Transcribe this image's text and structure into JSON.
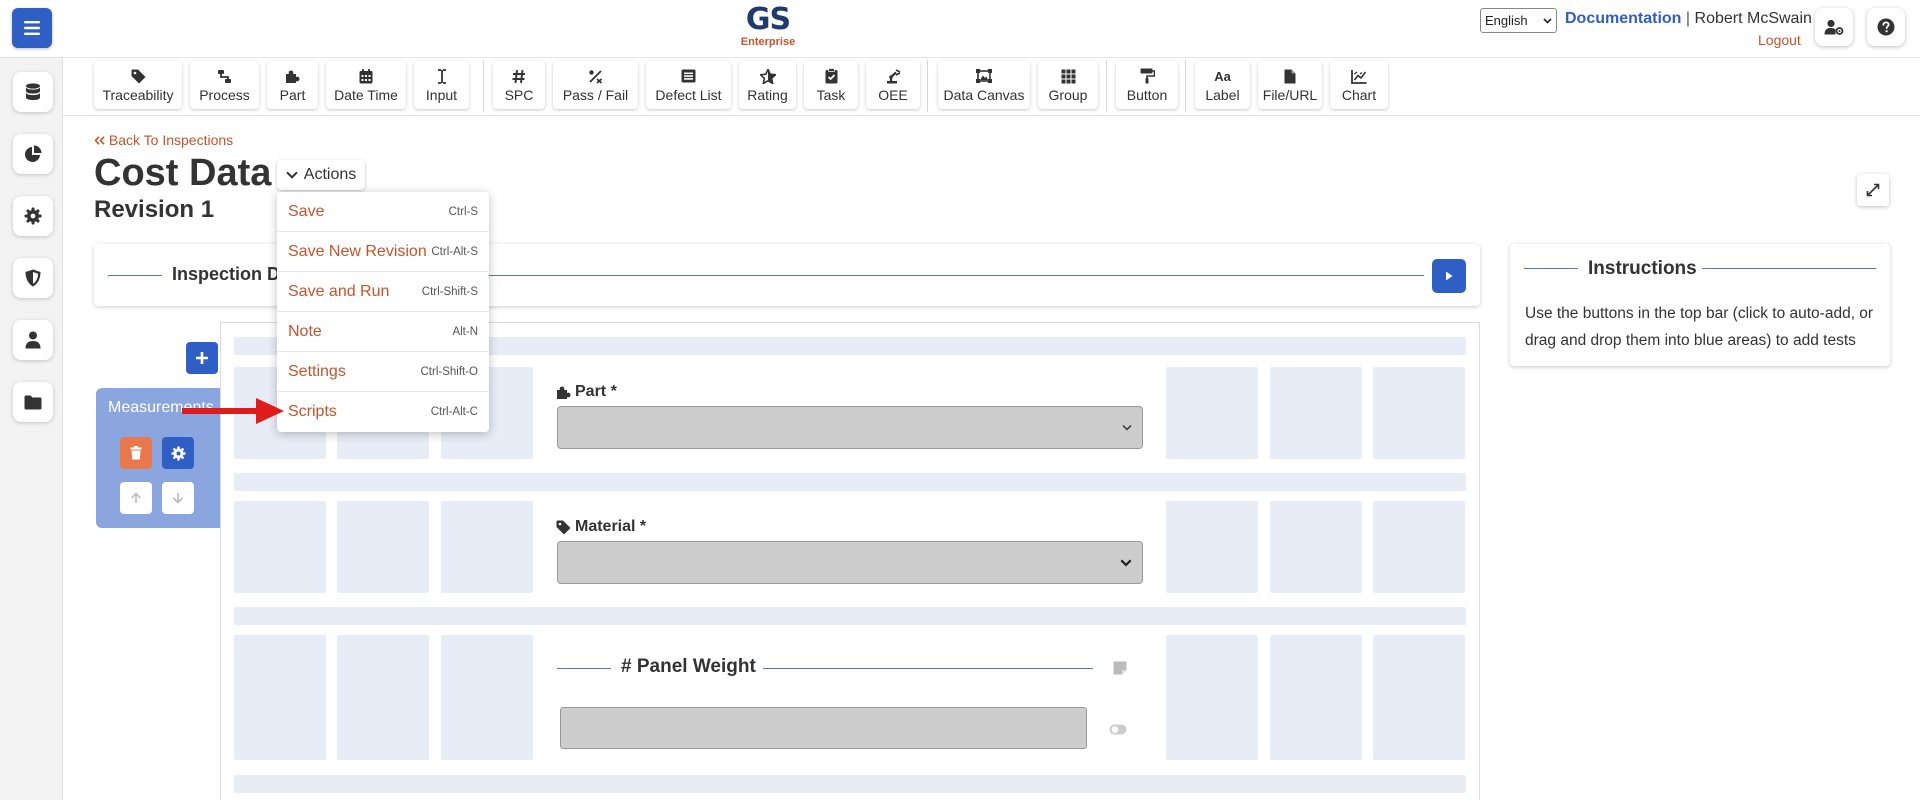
{
  "header": {
    "logo_main": "GS",
    "logo_sub": "Enterprise",
    "language": "English",
    "documentation": "Documentation",
    "separator": "|",
    "user_name": "Robert McSwain",
    "logout": "Logout",
    "colors": {
      "primary": "#2f5fc4",
      "accent": "#c7532c",
      "logo": "#1f3a6e"
    }
  },
  "sidebar": {
    "items": [
      {
        "icon": "database-icon"
      },
      {
        "icon": "pie-chart-icon"
      },
      {
        "icon": "gear-icon"
      },
      {
        "icon": "shield-icon"
      },
      {
        "icon": "user-icon"
      },
      {
        "icon": "folder-icon"
      }
    ]
  },
  "toolbar": {
    "tools": [
      {
        "label": "Traceability",
        "icon": "tag-icon"
      },
      {
        "label": "Process",
        "icon": "process-icon"
      },
      {
        "label": "Part",
        "icon": "puzzle-icon"
      },
      {
        "label": "Date Time",
        "icon": "calendar-icon"
      },
      {
        "label": "Input",
        "icon": "text-cursor-icon"
      },
      {
        "label": "SPC",
        "icon": "hash-icon"
      },
      {
        "label": "Pass / Fail",
        "icon": "percent-icon"
      },
      {
        "label": "Defect List",
        "icon": "list-icon"
      },
      {
        "label": "Rating",
        "icon": "star-icon"
      },
      {
        "label": "Task",
        "icon": "clipboard-check-icon"
      },
      {
        "label": "OEE",
        "icon": "robot-arm-icon"
      },
      {
        "label": "Data Canvas",
        "icon": "canvas-icon"
      },
      {
        "label": "Group",
        "icon": "grid-icon"
      },
      {
        "label": "Button",
        "icon": "paint-roller-icon"
      },
      {
        "label": "Label",
        "icon": "font-icon"
      },
      {
        "label": "File/URL",
        "icon": "file-icon"
      },
      {
        "label": "Chart",
        "icon": "chart-icon"
      }
    ],
    "aa_glyph": "Aa"
  },
  "main": {
    "back_link": "Back To Inspections",
    "title": "Cost Data",
    "revision": "Revision 1",
    "actions_label": "Actions",
    "actions_menu": [
      {
        "label": "Save",
        "shortcut": "Ctrl-S"
      },
      {
        "label": "Save New Revision",
        "shortcut": "Ctrl-Alt-S"
      },
      {
        "label": "Save and Run",
        "shortcut": "Ctrl-Shift-S"
      },
      {
        "label": "Note",
        "shortcut": "Alt-N"
      },
      {
        "label": "Settings",
        "shortcut": "Ctrl-Shift-O"
      },
      {
        "label": "Scripts",
        "shortcut": "Ctrl-Alt-C"
      }
    ],
    "inspection_title": "Inspection D",
    "instructions": {
      "title": "Instructions",
      "body": "Use the buttons in the top bar (click to auto-add, or drag and drop them into blue areas) to add tests"
    },
    "measurements_title": "Measurements",
    "fields": {
      "part_label": "Part *",
      "material_label": "Material *",
      "panel_weight_label": "Panel Weight",
      "panel_weight_hash": "#"
    }
  }
}
